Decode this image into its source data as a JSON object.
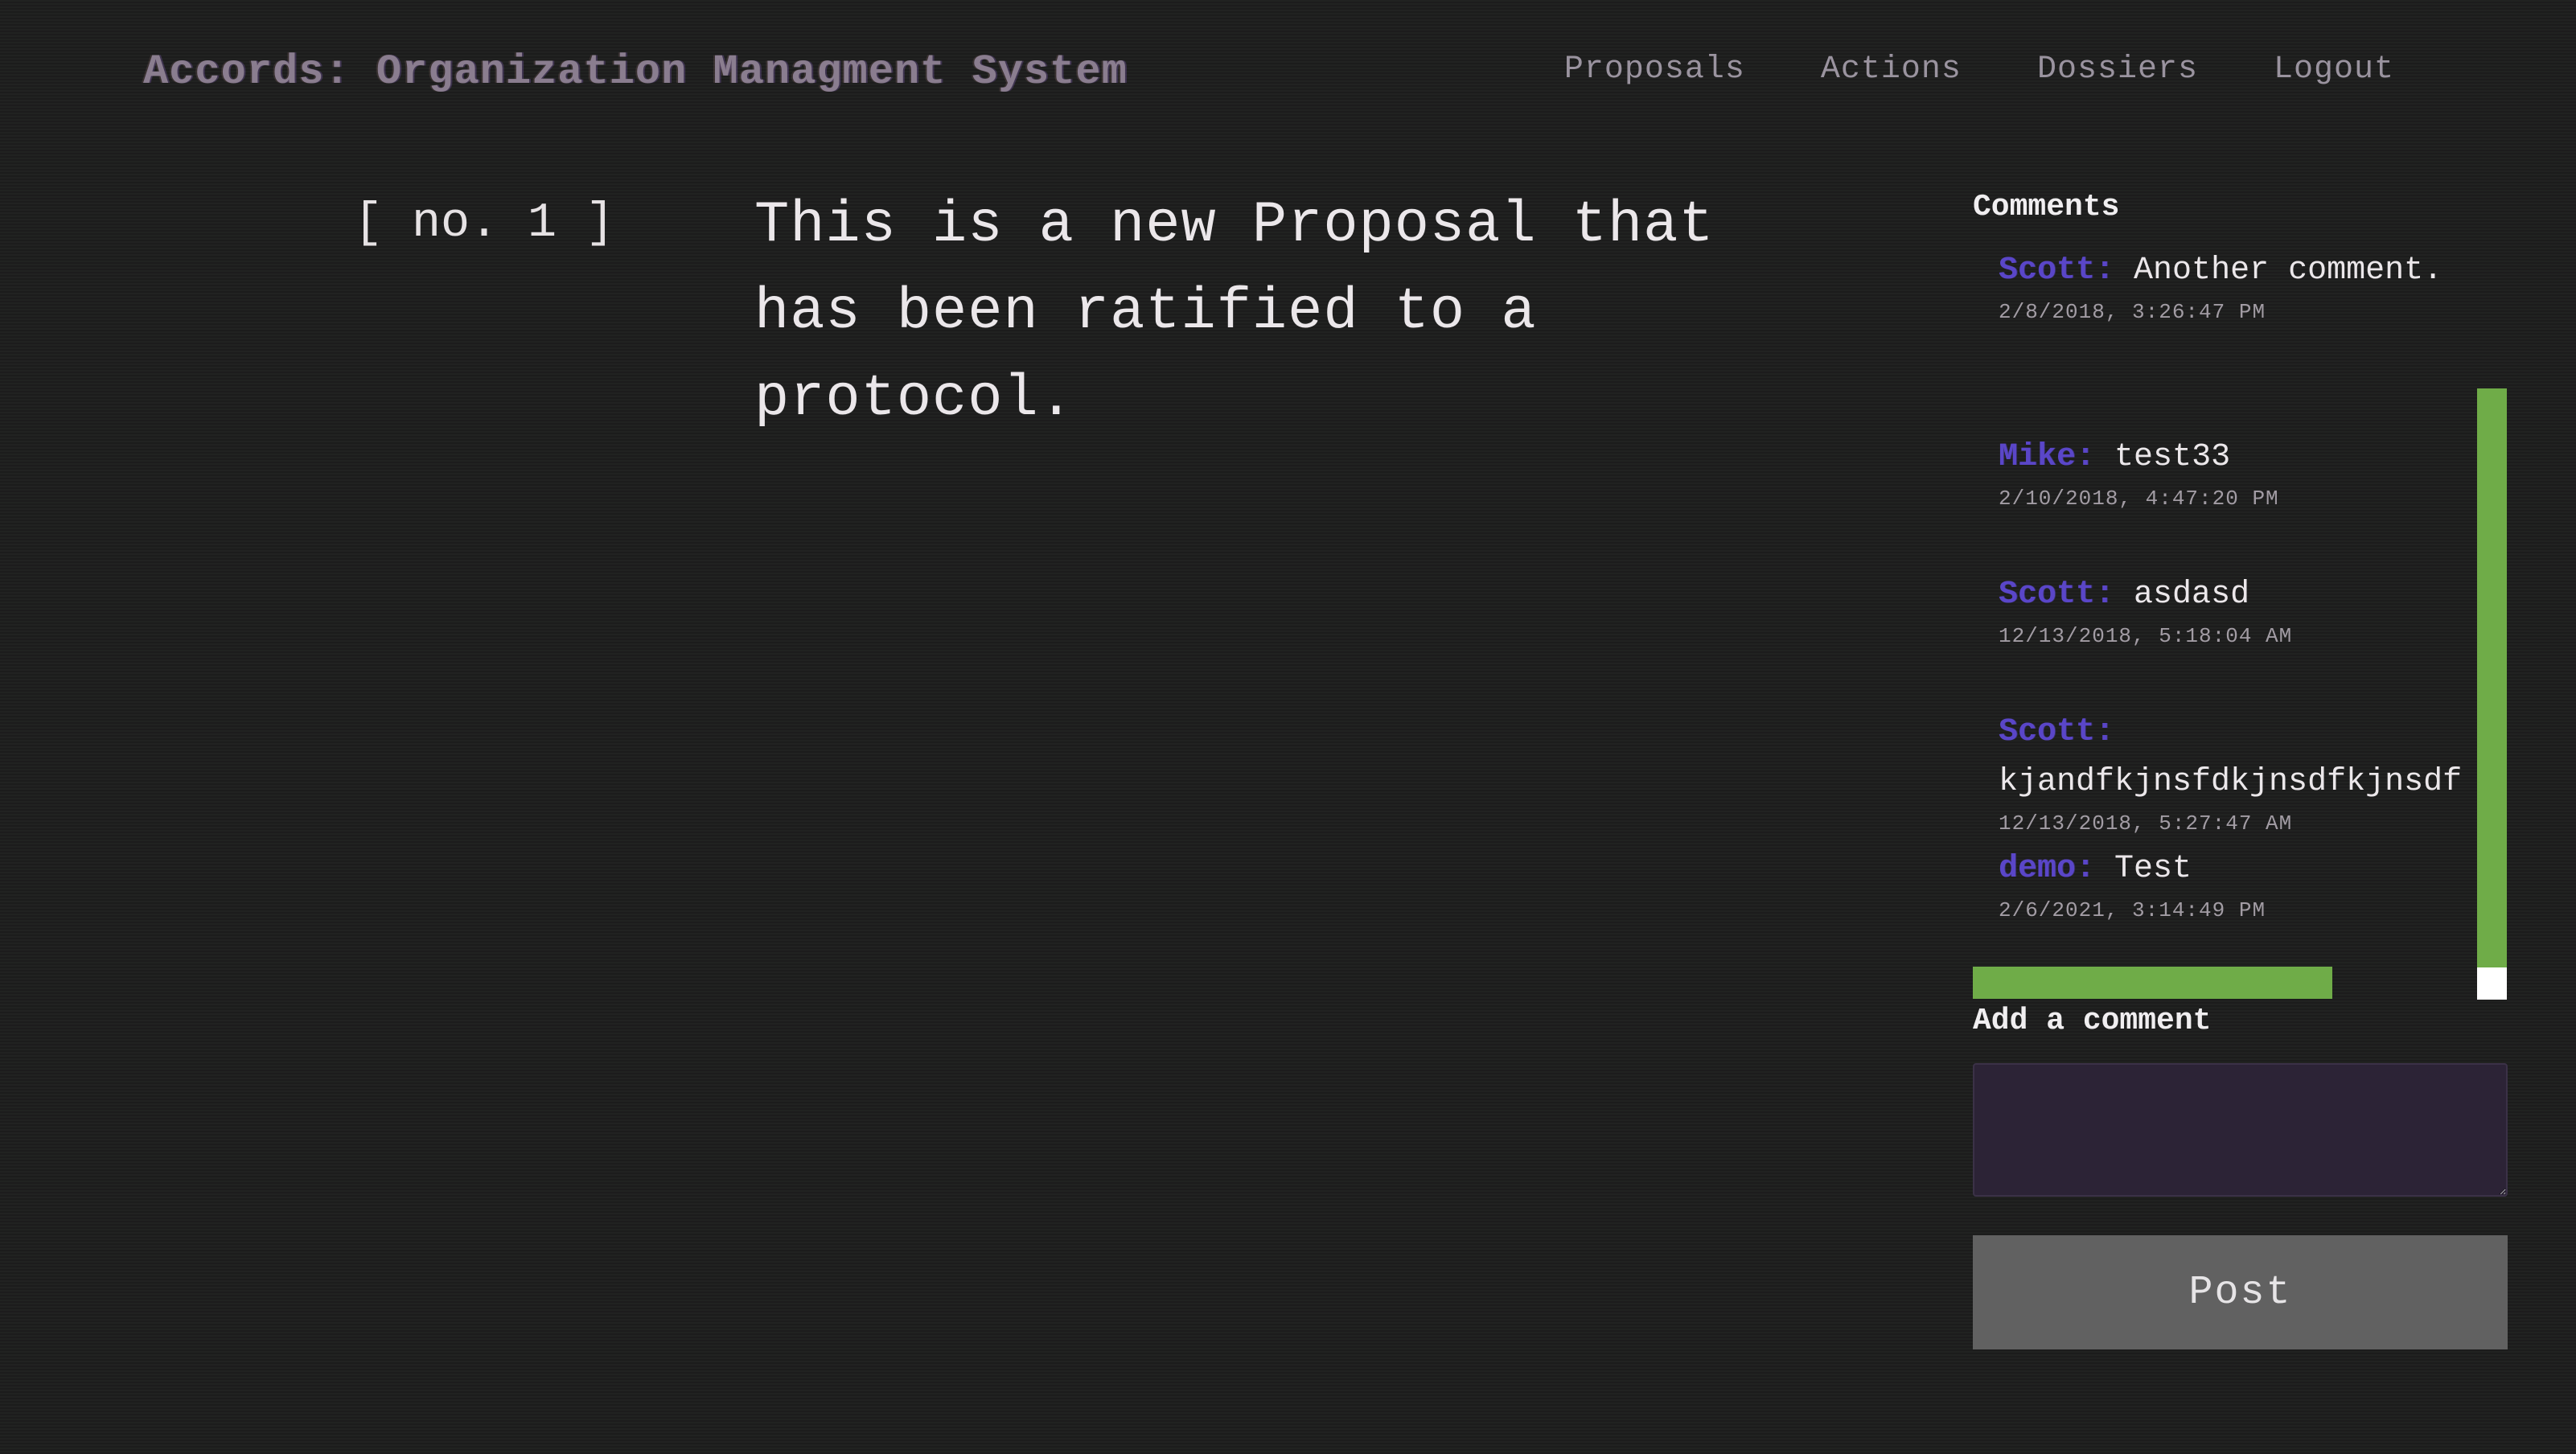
{
  "header": {
    "title": "Accords: Organization Managment System",
    "nav": [
      {
        "label": "Proposals"
      },
      {
        "label": "Actions"
      },
      {
        "label": "Dossiers"
      },
      {
        "label": "Logout"
      }
    ]
  },
  "proposal": {
    "number": "[ no. 1 ]",
    "text": "This is a new Proposal that has been ratified to a protocol."
  },
  "comments": {
    "heading": "Comments",
    "items": [
      {
        "author": "Scott:",
        "body": "Another comment.",
        "time": "2/8/2018, 3:26:47 PM"
      },
      {
        "author": "Mike:",
        "body": "test33",
        "time": "2/10/2018, 4:47:20 PM"
      },
      {
        "author": "Scott:",
        "body": "asdasd",
        "time": "12/13/2018, 5:18:04 AM"
      },
      {
        "author": "Scott:",
        "body": "kjandfkjnsfdkjnsdfkjnsdf",
        "time": "12/13/2018, 5:27:47 AM"
      },
      {
        "author": "demo:",
        "body": "Test",
        "time": "2/6/2021, 3:14:49 PM"
      }
    ],
    "add_label": "Add a comment",
    "input_value": "",
    "post_label": "Post"
  },
  "colors": {
    "background": "#1d1e1d",
    "author": "#5a46c8",
    "scrollbar": "#6fac48",
    "input_bg": "#2c2336",
    "button_bg": "#616161"
  }
}
